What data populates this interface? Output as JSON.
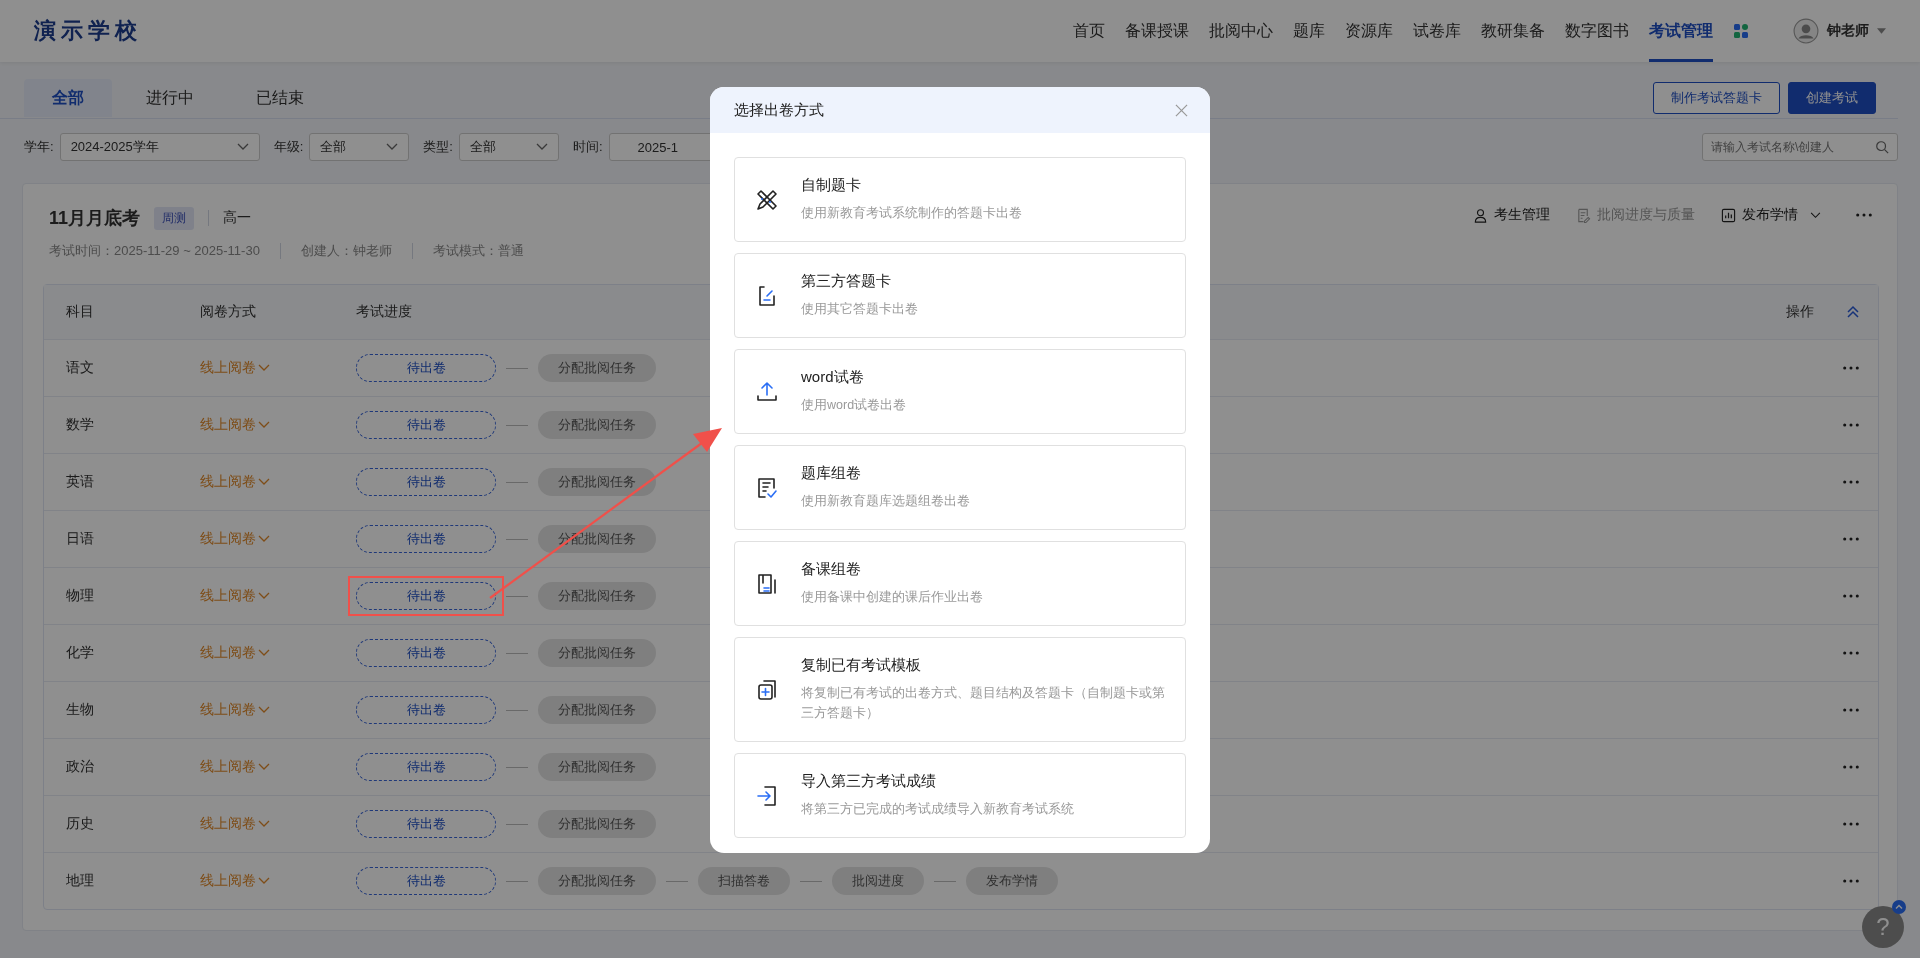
{
  "header": {
    "logo": "演示学校",
    "nav": [
      {
        "label": "首页",
        "selected": false
      },
      {
        "label": "备课授课",
        "selected": false
      },
      {
        "label": "批阅中心",
        "selected": false
      },
      {
        "label": "题库",
        "selected": false
      },
      {
        "label": "资源库",
        "selected": false
      },
      {
        "label": "试卷库",
        "selected": false
      },
      {
        "label": "教研集备",
        "selected": false
      },
      {
        "label": "数字图书",
        "selected": false
      },
      {
        "label": "考试管理",
        "selected": true
      }
    ],
    "user": {
      "name": "钟老师"
    }
  },
  "tabs": [
    {
      "label": "全部",
      "selected": true
    },
    {
      "label": "进行中",
      "selected": false
    },
    {
      "label": "已结束",
      "selected": false
    }
  ],
  "toolbar_buttons": [
    {
      "label": "制作考试答题卡",
      "kind": "outline"
    },
    {
      "label": "创建考试",
      "kind": "primary"
    }
  ],
  "filters": [
    {
      "label": "学年:",
      "value": "2024-2025学年",
      "kind": "select"
    },
    {
      "label": "年级:",
      "value": "全部",
      "kind": "select"
    },
    {
      "label": "类型:",
      "value": "全部",
      "kind": "select"
    },
    {
      "label": "时间:",
      "value": "2025-1",
      "kind": "date"
    }
  ],
  "search": {
    "placeholder": "请输入考试名称\\创建人"
  },
  "exam": {
    "title": "11月月底考",
    "tag": "周测",
    "grade": "高一",
    "meta": [
      "考试时间：2025-11-29 ~ 2025-11-30",
      "创建人：钟老师",
      "考试模式：普通"
    ],
    "actions": [
      {
        "label": "考生管理",
        "disabled": false,
        "dropdown": false
      },
      {
        "label": "批阅进度与质量",
        "disabled": true,
        "dropdown": false
      },
      {
        "label": "发布学情",
        "disabled": false,
        "dropdown": true
      }
    ]
  },
  "table": {
    "columns": [
      "科目",
      "阅卷方式",
      "考试进度",
      "操作"
    ],
    "rows": [
      {
        "subject": "语文",
        "grading": "线上阅卷",
        "highlighted": false,
        "steps": [
          {
            "label": "待出卷",
            "kind": "current"
          },
          {
            "label": "分配批阅任务",
            "kind": "pending"
          }
        ]
      },
      {
        "subject": "数学",
        "grading": "线上阅卷",
        "highlighted": false,
        "steps": [
          {
            "label": "待出卷",
            "kind": "current"
          },
          {
            "label": "分配批阅任务",
            "kind": "pending"
          }
        ]
      },
      {
        "subject": "英语",
        "grading": "线上阅卷",
        "highlighted": false,
        "steps": [
          {
            "label": "待出卷",
            "kind": "current"
          },
          {
            "label": "分配批阅任务",
            "kind": "pending"
          }
        ]
      },
      {
        "subject": "日语",
        "grading": "线上阅卷",
        "highlighted": false,
        "steps": [
          {
            "label": "待出卷",
            "kind": "current"
          },
          {
            "label": "分配批阅任务",
            "kind": "pending"
          }
        ]
      },
      {
        "subject": "物理",
        "grading": "线上阅卷",
        "highlighted": true,
        "steps": [
          {
            "label": "待出卷",
            "kind": "current"
          },
          {
            "label": "分配批阅任务",
            "kind": "pending"
          }
        ]
      },
      {
        "subject": "化学",
        "grading": "线上阅卷",
        "highlighted": false,
        "steps": [
          {
            "label": "待出卷",
            "kind": "current"
          },
          {
            "label": "分配批阅任务",
            "kind": "pending"
          }
        ]
      },
      {
        "subject": "生物",
        "grading": "线上阅卷",
        "highlighted": false,
        "steps": [
          {
            "label": "待出卷",
            "kind": "current"
          },
          {
            "label": "分配批阅任务",
            "kind": "pending"
          }
        ]
      },
      {
        "subject": "政治",
        "grading": "线上阅卷",
        "highlighted": false,
        "steps": [
          {
            "label": "待出卷",
            "kind": "current"
          },
          {
            "label": "分配批阅任务",
            "kind": "pending"
          }
        ]
      },
      {
        "subject": "历史",
        "grading": "线上阅卷",
        "highlighted": false,
        "steps": [
          {
            "label": "待出卷",
            "kind": "current"
          },
          {
            "label": "分配批阅任务",
            "kind": "pending"
          }
        ]
      },
      {
        "subject": "地理",
        "grading": "线上阅卷",
        "highlighted": false,
        "steps": [
          {
            "label": "待出卷",
            "kind": "current"
          },
          {
            "label": "分配批阅任务",
            "kind": "pending"
          },
          {
            "label": "扫描答卷",
            "kind": "pending"
          },
          {
            "label": "批阅进度",
            "kind": "pending"
          },
          {
            "label": "发布学情",
            "kind": "pending"
          }
        ]
      }
    ]
  },
  "dialog": {
    "title": "选择出卷方式",
    "options": [
      {
        "title": "自制题卡",
        "description": "使用新教育考试系统制作的答题卡出卷"
      },
      {
        "title": "第三方答题卡",
        "description": "使用其它答题卡出卷"
      },
      {
        "title": "word试卷",
        "description": "使用word试卷出卷"
      },
      {
        "title": "题库组卷",
        "description": "使用新教育题库选题组卷出卷"
      },
      {
        "title": "备课组卷",
        "description": "使用备课中创建的课后作业出卷"
      },
      {
        "title": "复制已有考试模板",
        "description": "将复制已有考试的出卷方式、题目结构及答题卡（自制题卡或第三方答题卡）"
      },
      {
        "title": "导入第三方考试成绩",
        "description": "将第三方已完成的考试成绩导入新教育考试系统"
      }
    ]
  },
  "help": {
    "label": "?"
  }
}
